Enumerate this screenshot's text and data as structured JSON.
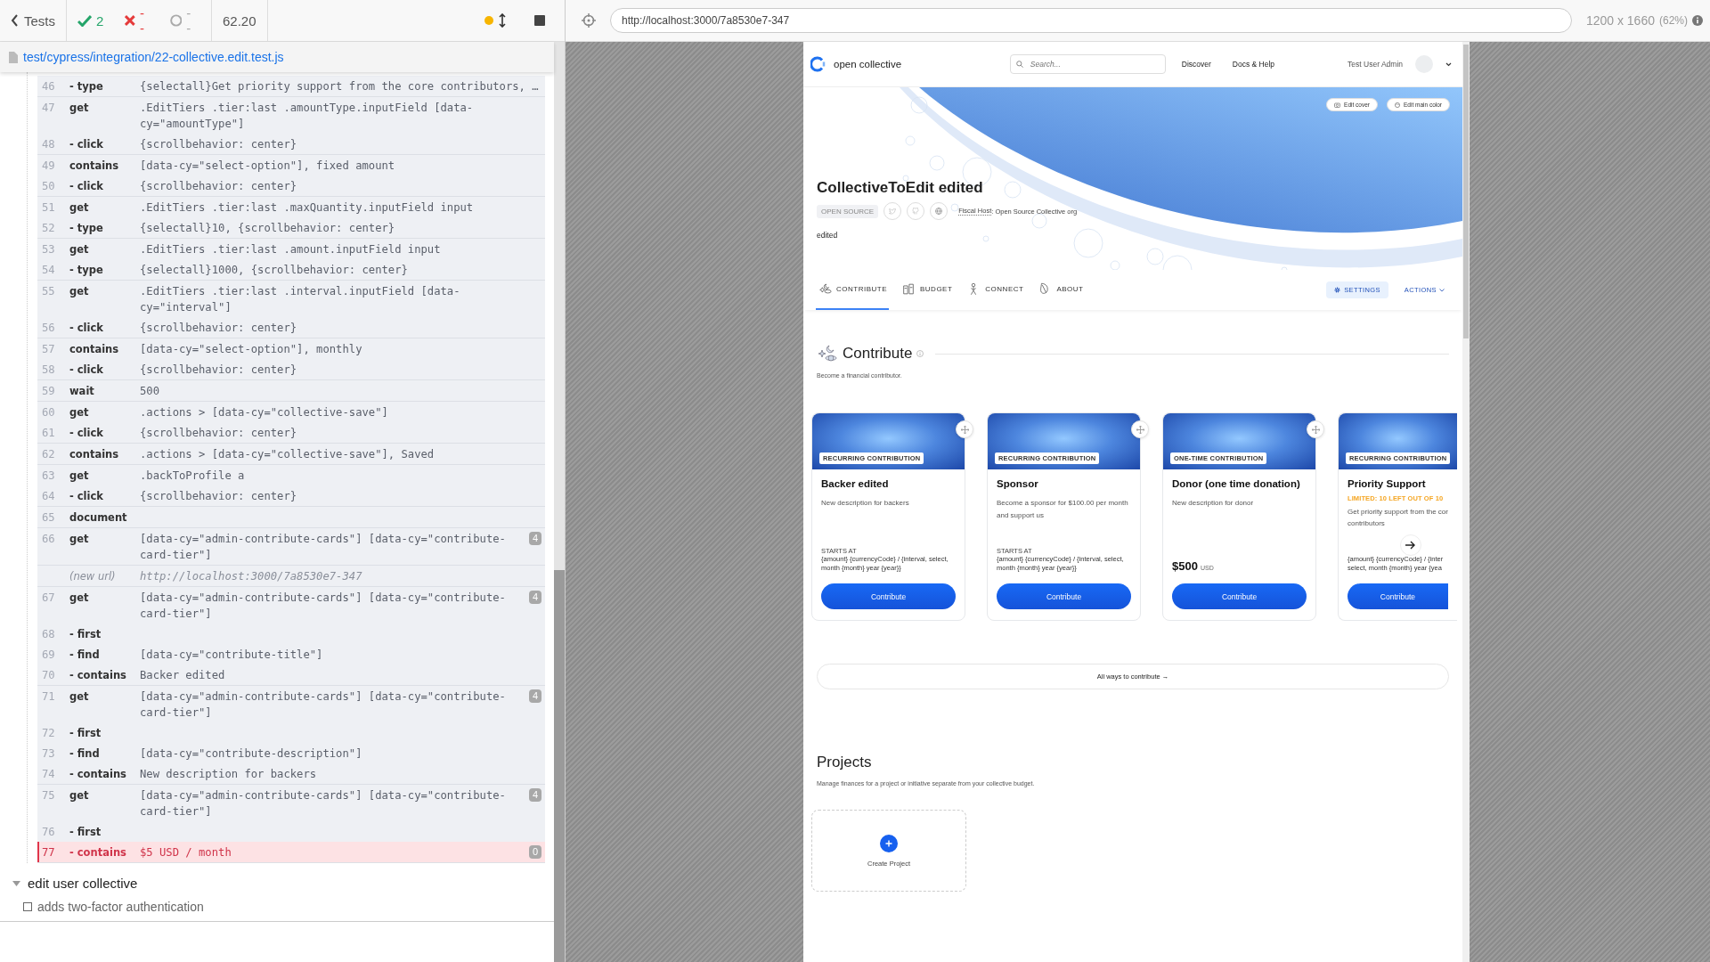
{
  "runner": {
    "back_label": "Tests",
    "passed": "2",
    "failed": "--",
    "pending": "--",
    "duration": "62.20",
    "spec_file": "test/cypress/integration/22-collective.edit.test.js"
  },
  "command_log": {
    "groups": [
      {
        "rows": [
          {
            "num": "46",
            "command": "- type",
            "message": "{selectall}Get priority support from the core contributors, …",
            "kind": "command"
          }
        ]
      },
      {
        "rows": [
          {
            "num": "47",
            "command": "get",
            "message": ".EditTiers .tier:last .amountType.inputField [data-cy=\"amountType\"]",
            "kind": "command"
          },
          {
            "num": "48",
            "command": "- click",
            "message": "{scrollbehavior: center}",
            "kind": "command"
          }
        ]
      },
      {
        "rows": [
          {
            "num": "49",
            "command": "contains",
            "message": "[data-cy=\"select-option\"], fixed amount",
            "kind": "command"
          },
          {
            "num": "50",
            "command": "- click",
            "message": "{scrollbehavior: center}",
            "kind": "command"
          }
        ]
      },
      {
        "rows": [
          {
            "num": "51",
            "command": "get",
            "message": ".EditTiers .tier:last .maxQuantity.inputField input",
            "kind": "command"
          },
          {
            "num": "52",
            "command": "- type",
            "message": "{selectall}10, {scrollbehavior: center}",
            "kind": "command"
          }
        ]
      },
      {
        "rows": [
          {
            "num": "53",
            "command": "get",
            "message": ".EditTiers .tier:last .amount.inputField input",
            "kind": "command"
          },
          {
            "num": "54",
            "command": "- type",
            "message": "{selectall}1000, {scrollbehavior: center}",
            "kind": "command"
          }
        ]
      },
      {
        "rows": [
          {
            "num": "55",
            "command": "get",
            "message": ".EditTiers .tier:last .interval.inputField [data-cy=\"interval\"]",
            "kind": "command"
          },
          {
            "num": "56",
            "command": "- click",
            "message": "{scrollbehavior: center}",
            "kind": "command"
          }
        ]
      },
      {
        "rows": [
          {
            "num": "57",
            "command": "contains",
            "message": "[data-cy=\"select-option\"], monthly",
            "kind": "command"
          },
          {
            "num": "58",
            "command": "- click",
            "message": "{scrollbehavior: center}",
            "kind": "command"
          }
        ]
      },
      {
        "rows": [
          {
            "num": "59",
            "command": "wait",
            "message": "500",
            "kind": "command"
          }
        ]
      },
      {
        "rows": [
          {
            "num": "60",
            "command": "get",
            "message": ".actions > [data-cy=\"collective-save\"]",
            "kind": "command"
          },
          {
            "num": "61",
            "command": "- click",
            "message": "{scrollbehavior: center}",
            "kind": "command"
          }
        ]
      },
      {
        "rows": [
          {
            "num": "62",
            "command": "contains",
            "message": ".actions > [data-cy=\"collective-save\"], Saved",
            "kind": "command"
          }
        ]
      },
      {
        "rows": [
          {
            "num": "63",
            "command": "get",
            "message": ".backToProfile a",
            "kind": "command"
          },
          {
            "num": "64",
            "command": "- click",
            "message": "{scrollbehavior: center}",
            "kind": "command"
          }
        ]
      },
      {
        "rows": [
          {
            "num": "65",
            "command": "document",
            "kind": "command"
          }
        ]
      },
      {
        "rows": [
          {
            "num": "66",
            "command": "get",
            "message": "[data-cy=\"admin-contribute-cards\"] [data-cy=\"contribute-card-tier\"]",
            "badge": "4",
            "kind": "command"
          }
        ]
      },
      {
        "rows": [
          {
            "command": "(new url)",
            "message": "http://localhost:3000/7a8530e7-347",
            "kind": "event"
          }
        ]
      },
      {
        "rows": [
          {
            "num": "67",
            "command": "get",
            "message": "[data-cy=\"admin-contribute-cards\"] [data-cy=\"contribute-card-tier\"]",
            "badge": "4",
            "kind": "command"
          },
          {
            "num": "68",
            "command": "- first",
            "kind": "command"
          },
          {
            "num": "69",
            "command": "- find",
            "message": "[data-cy=\"contribute-title\"]",
            "kind": "command"
          },
          {
            "num": "70",
            "command": "- contains",
            "message": "Backer edited",
            "kind": "command"
          }
        ]
      },
      {
        "rows": [
          {
            "num": "71",
            "command": "get",
            "message": "[data-cy=\"admin-contribute-cards\"] [data-cy=\"contribute-card-tier\"]",
            "badge": "4",
            "kind": "command"
          },
          {
            "num": "72",
            "command": "- first",
            "kind": "command"
          },
          {
            "num": "73",
            "command": "- find",
            "message": "[data-cy=\"contribute-description\"]",
            "kind": "command"
          },
          {
            "num": "74",
            "command": "- contains",
            "message": "New description for backers",
            "kind": "command"
          }
        ]
      },
      {
        "rows": [
          {
            "num": "75",
            "command": "get",
            "message": "[data-cy=\"admin-contribute-cards\"] [data-cy=\"contribute-card-tier\"]",
            "badge": "4",
            "kind": "command"
          },
          {
            "num": "76",
            "command": "- first",
            "kind": "command"
          },
          {
            "num": "77",
            "command": "- contains",
            "message": "$5 USD / month",
            "badge": "0",
            "kind": "failed"
          }
        ]
      }
    ],
    "suite": {
      "title": "edit user collective",
      "expanded": true
    },
    "tests": [
      {
        "title": "adds two-factor authentication"
      }
    ]
  },
  "browser": {
    "url": "http://localhost:3000/7a8530e7-347",
    "viewport": "1200 x 1660",
    "zoom": "(62%)"
  },
  "app": {
    "header": {
      "logo": "open collective",
      "search_placeholder": "Search...",
      "nav": [
        "Discover",
        "Docs & Help"
      ],
      "user": "Test User Admin"
    },
    "hero": {
      "cover_buttons": [
        "Edit cover",
        "Edit main color"
      ],
      "name": "CollectiveToEdit edited",
      "tag": "OPEN SOURCE",
      "fiscal_host_label": "Fiscal Host",
      "fiscal_host_text": ": Open Source Collective org",
      "description": "edited"
    },
    "tabs": [
      {
        "label": "CONTRIBUTE",
        "selected": true
      },
      {
        "label": "BUDGET",
        "selected": false
      },
      {
        "label": "CONNECT",
        "selected": false
      },
      {
        "label": "ABOUT",
        "selected": false
      }
    ],
    "settings": "SETTINGS",
    "actions": "ACTIONS",
    "contribute": {
      "title": "Contribute",
      "subtitle": "Become a financial contributor.",
      "cards": [
        {
          "type": "RECURRING CONTRIBUTION",
          "title": "Backer edited",
          "description": "New description for backers",
          "starts_at": "STARTS AT",
          "amount": "{amount} {currencyCode} / {interval, select, month {month} year {year}}",
          "button": "Contribute",
          "cut": false
        },
        {
          "type": "RECURRING CONTRIBUTION",
          "title": "Sponsor",
          "description": "Become a sponsor for $100.00 per month and support us",
          "starts_at": "STARTS AT",
          "amount": "{amount} {currencyCode} / {interval, select, month {month} year {year}}",
          "button": "Contribute",
          "cut": false
        },
        {
          "type": "ONE-TIME CONTRIBUTION",
          "title": "Donor (one time donation)",
          "description": "New description for donor",
          "price": "$500",
          "currency": "USD",
          "button": "Contribute",
          "cut": false
        },
        {
          "type": "RECURRING CONTRIBUTION",
          "title": "Priority Support",
          "limit": "LIMITED: 10 LEFT OUT OF 10",
          "description": "Get priority support from the cor\ncontributors",
          "amount": "{amount} {currencyCode} / {inter\nselect, month {month} year {yea",
          "button": "Contribute",
          "cut": true
        }
      ],
      "all_ways": "All ways to contribute →"
    },
    "projects": {
      "title": "Projects",
      "subtitle": "Manage finances for a project or initiative separate from your collective budget.",
      "create": "Create Project"
    }
  }
}
